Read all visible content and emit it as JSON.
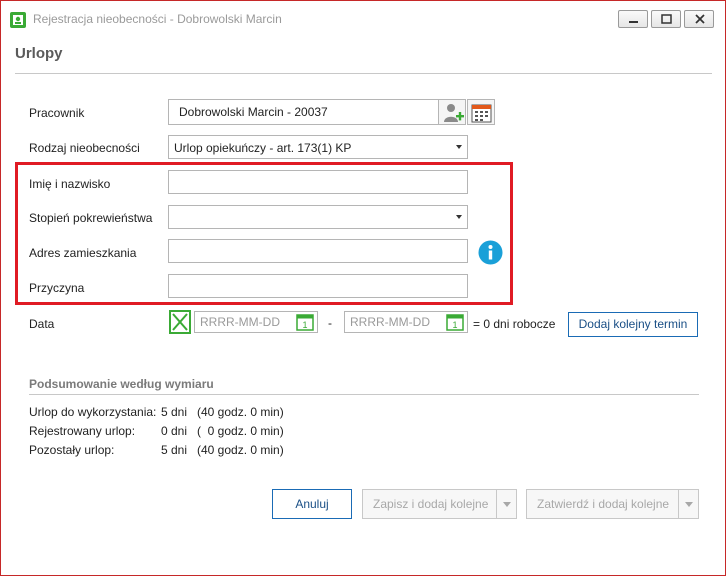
{
  "window": {
    "title": "Rejestracja nieobecności - Dobrowolski Marcin"
  },
  "header": {
    "title": "Urlopy"
  },
  "form": {
    "employee_label": "Pracownik",
    "employee_value": "Dobrowolski Marcin - 20037",
    "absence_type_label": "Rodzaj nieobecności",
    "absence_type_value": "Urlop opiekuńczy - art. 173(1) KP",
    "name_label": "Imię i nazwisko",
    "name_value": "",
    "relation_label": "Stopień pokrewieństwa",
    "relation_value": "",
    "address_label": "Adres zamieszkania",
    "address_value": "",
    "reason_label": "Przyczyna",
    "reason_value": "",
    "date_label": "Data",
    "date_from_placeholder": "RRRR-MM-DD",
    "date_to_placeholder": "RRRR-MM-DD",
    "date_separator": "-",
    "workdays_text": "= 0 dni robocze",
    "add_term_label": "Dodaj kolejny termin"
  },
  "summary": {
    "title": "Podsumowanie według wymiaru",
    "rows": [
      {
        "label": "Urlop do wykorzystania:",
        "days": "5 dni",
        "hours": "(40 godz. 0 min)"
      },
      {
        "label": "Rejestrowany urlop:",
        "days": "0 dni",
        "hours": "(  0 godz. 0 min)"
      },
      {
        "label": "Pozostały urlop:",
        "days": "5 dni",
        "hours": "(40 godz. 0 min)"
      }
    ]
  },
  "footer": {
    "cancel_label": "Anuluj",
    "save_add_label": "Zapisz i dodaj kolejne",
    "confirm_add_label": "Zatwierdź i dodaj kolejne"
  },
  "icons": {
    "app": "app-icon",
    "add_person": "add-person-icon",
    "calendar": "calendar-icon",
    "info": "info-icon",
    "clear": "clear-x-icon"
  },
  "colors": {
    "highlight_border": "#e01b24",
    "accent_blue": "#1a6bb5",
    "info_blue": "#1aa0d8",
    "green": "#3aaa35"
  }
}
